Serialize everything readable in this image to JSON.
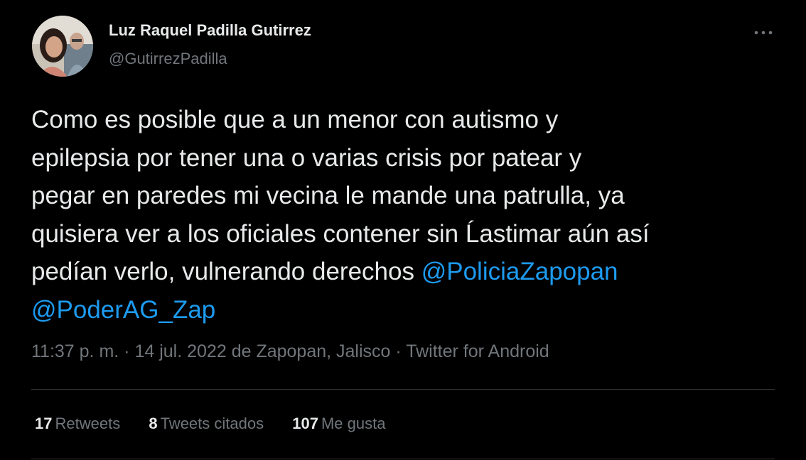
{
  "author": {
    "name": "Luz Raquel Padilla Gutirrez",
    "handle": "@GutirrezPadilla"
  },
  "tweet": {
    "text_lines": [
      "Como es posible que a un menor con autismo y",
      "epilepsia por tener una o varias crisis por patear y",
      "pegar en paredes mi vecina le mande una patrulla, ya",
      "quisiera ver a los oficiales contener sin Ĺastimar aún así",
      "pedían verlo, vulnerando derechos "
    ],
    "mentions": [
      "@PoliciaZapopan",
      "@PoderAG_Zap"
    ]
  },
  "meta": {
    "time": "11:37 p. m.",
    "date": "14 jul. 2022",
    "location": "de Zapopan, Jalisco",
    "source": "Twitter for Android",
    "separator": "·"
  },
  "stats": {
    "retweets_count": "17",
    "retweets_label": "Retweets",
    "quotes_count": "8",
    "quotes_label": "Tweets citados",
    "likes_count": "107",
    "likes_label": "Me gusta"
  },
  "icons": {
    "more": "more-icon"
  },
  "colors": {
    "background": "#000000",
    "text": "#e7e9ea",
    "secondary": "#71767b",
    "link": "#1d9bf0",
    "divider": "#2f3336"
  }
}
